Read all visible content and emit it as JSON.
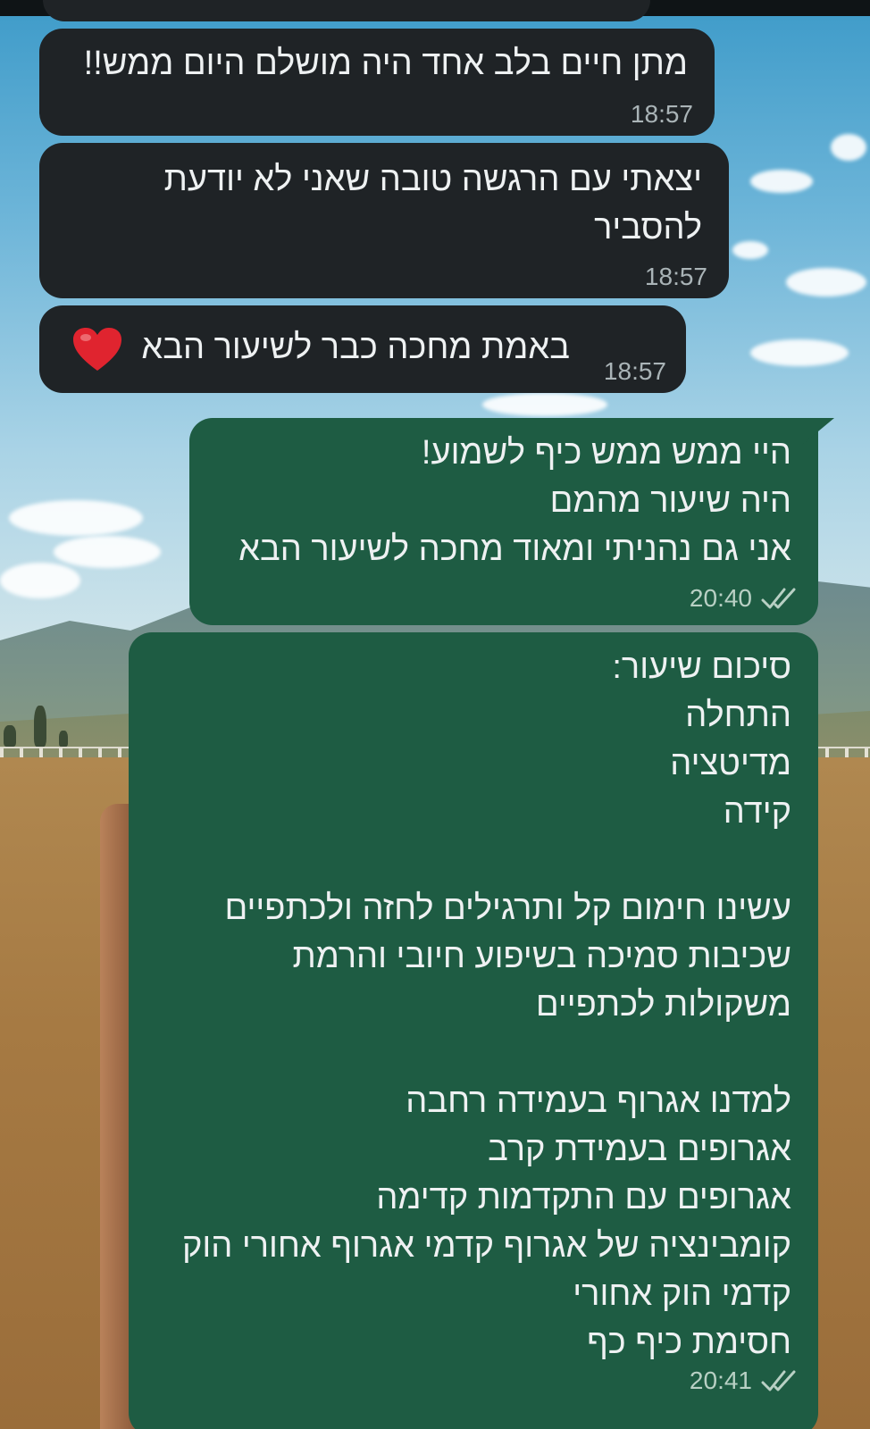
{
  "messages": [
    {
      "direction": "incoming",
      "text": "מתן חיים בלב אחד היה מושלם היום ממש!!",
      "time": "18:57"
    },
    {
      "direction": "incoming",
      "text": "יצאתי עם הרגשה טובה שאני לא יודעת\nלהסביר",
      "time": "18:57"
    },
    {
      "direction": "incoming",
      "text": "באמת מחכה כבר לשיעור הבא",
      "emoji": "red-heart",
      "time": "18:57"
    },
    {
      "direction": "outgoing",
      "text": "היי ממש ממש כיף לשמוע!\nהיה שיעור מהמם\nאני גם נהניתי ומאוד מחכה לשיעור הבא",
      "time": "20:40",
      "status": "read"
    },
    {
      "direction": "outgoing",
      "text": "סיכום שיעור:\nהתחלה\nמדיטציה\nקידה\n\nעשינו חימום קל ותרגילים לחזה ולכתפיים\nשכיבות סמיכה בשיפוע חיובי והרמת\nמשקולות לכתפיים\n\nלמדנו אגרוף בעמידה רחבה\nאגרופים בעמידת קרב\nאגרופים עם התקדמות קדימה\nקומבינציה של אגרוף קדמי אגרוף אחורי הוק\nקדמי הוק אחורי\nחסימת כיף כף",
      "time": "20:41",
      "status": "read"
    }
  ],
  "colors": {
    "incoming_bubble": "#1f2326",
    "outgoing_bubble": "#1e5c43",
    "text": "#eef1f2",
    "read_ticks": "#b8d0c4",
    "heart": "#e0242f"
  }
}
